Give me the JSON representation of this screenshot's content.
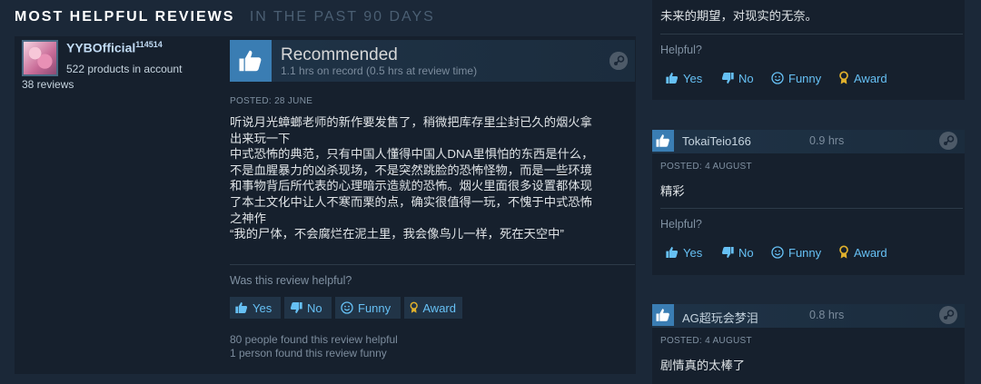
{
  "section": {
    "title": "MOST HELPFUL REVIEWS",
    "subtitle": "IN THE PAST 90 DAYS"
  },
  "main_review": {
    "author": {
      "name": "YYBOfficial",
      "level": "114514",
      "products": "522 products in account",
      "reviews": "38 reviews"
    },
    "verdict": "Recommended",
    "hours": "1.1 hrs on record (0.5 hrs at review time)",
    "posted": "POSTED: 28 JUNE",
    "text_lines": [
      "听说月光蟑螂老师的新作要发售了，稍微把库存里尘封已久的烟火拿",
      "出来玩一下",
      "中式恐怖的典范，只有中国人懂得中国人DNA里惧怕的东西是什么，",
      "不是血腥暴力的凶杀现场，不是突然跳脸的恐怖怪物，而是一些环境",
      "和事物背后所代表的心理暗示造就的恐怖。烟火里面很多设置都体现",
      "了本土文化中让人不寒而栗的点，确实很值得一玩，不愧于中式恐怖",
      "之神作",
      "“我的尸体，不会腐烂在泥土里，我会像鸟儿一样，死在天空中”"
    ],
    "helpful_question": "Was this review helpful?",
    "buttons": {
      "yes": "Yes",
      "no": "No",
      "funny": "Funny",
      "award": "Award"
    },
    "found_helpful": "80 people found this review helpful",
    "found_funny": "1 person found this review funny"
  },
  "side_reviews": [
    {
      "text_fragment": "未来的期望，对现实的无奈。",
      "helpful_question": "Helpful?",
      "buttons": {
        "yes": "Yes",
        "no": "No",
        "funny": "Funny",
        "award": "Award"
      }
    },
    {
      "name": "TokaiTeio166",
      "hours": "0.9 hrs",
      "posted": "POSTED: 4 AUGUST",
      "text": "精彩",
      "helpful_question": "Helpful?",
      "buttons": {
        "yes": "Yes",
        "no": "No",
        "funny": "Funny",
        "award": "Award"
      }
    },
    {
      "name": "AG超玩会梦泪",
      "hours": "0.8 hrs",
      "posted": "POSTED: 4 AUGUST",
      "text": "剧情真的太棒了"
    }
  ],
  "colors": {
    "background": "#1b2838",
    "card": "#16202d",
    "accent_blue": "#66c0f4",
    "thumb_bg": "#3a7db3",
    "award_gold": "#e1b12c"
  }
}
